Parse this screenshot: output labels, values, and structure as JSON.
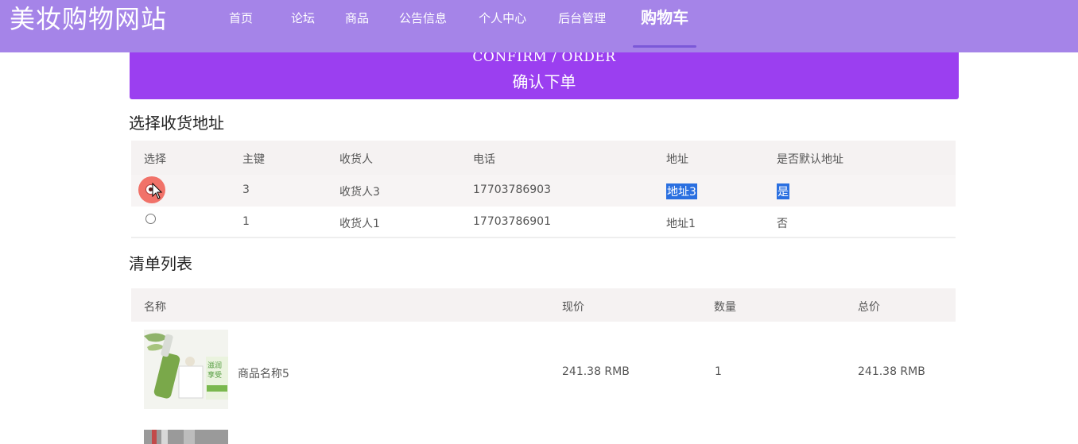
{
  "app": {
    "brand": "美妆购物网站",
    "nav": [
      {
        "label": "首页"
      },
      {
        "label": "论坛"
      },
      {
        "label": "商品"
      },
      {
        "label": "公告信息"
      },
      {
        "label": "个人中心"
      },
      {
        "label": "后台管理"
      },
      {
        "label": "购物车",
        "active": true
      }
    ]
  },
  "banner": {
    "en": "CONFIRM / ORDER",
    "zh": "确认下单"
  },
  "address": {
    "title": "选择收货地址",
    "headers": [
      "选择",
      "主键",
      "收货人",
      "电话",
      "地址",
      "是否默认地址"
    ],
    "rows": [
      {
        "selected": true,
        "id": "3",
        "receiver": "收货人3",
        "phone": "17703786903",
        "address": "地址3",
        "is_default": "是"
      },
      {
        "selected": false,
        "id": "1",
        "receiver": "收货人1",
        "phone": "17703786901",
        "address": "地址1",
        "is_default": "否"
      }
    ]
  },
  "order": {
    "title": "清单列表",
    "headers": [
      "名称",
      "现价",
      "数量",
      "总价"
    ],
    "items": [
      {
        "name": "商品名称5",
        "price": "241.38 RMB",
        "qty": "1",
        "total": "241.38 RMB",
        "thumb_text": [
          "滋润",
          "享受"
        ]
      }
    ]
  },
  "colors": {
    "nav_bg": "#a584e8",
    "banner_bg": "#9b3ff0",
    "highlight": "#2a6fe0"
  }
}
